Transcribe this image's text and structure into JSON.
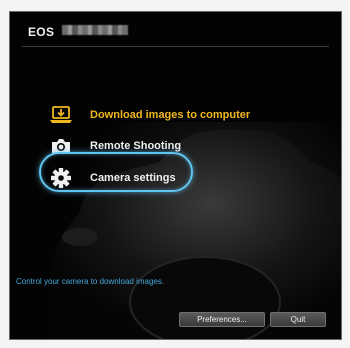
{
  "window": {
    "title": "EOS",
    "title_redacted_icon": "pixelated-name"
  },
  "menu": {
    "items": [
      {
        "label": "Download images to computer",
        "icon": "laptop-download-icon",
        "color": "#f0b820"
      },
      {
        "label": "Remote Shooting",
        "icon": "camera-icon",
        "color": "#f0f0f0"
      },
      {
        "label": "Camera settings",
        "icon": "gear-icon",
        "color": "#f0f0f0"
      }
    ],
    "highlight_color": "#5fc4f0"
  },
  "status": {
    "text": "Control your camera to download images."
  },
  "buttons": {
    "preferences": "Preferences...",
    "quit": "Quit"
  }
}
